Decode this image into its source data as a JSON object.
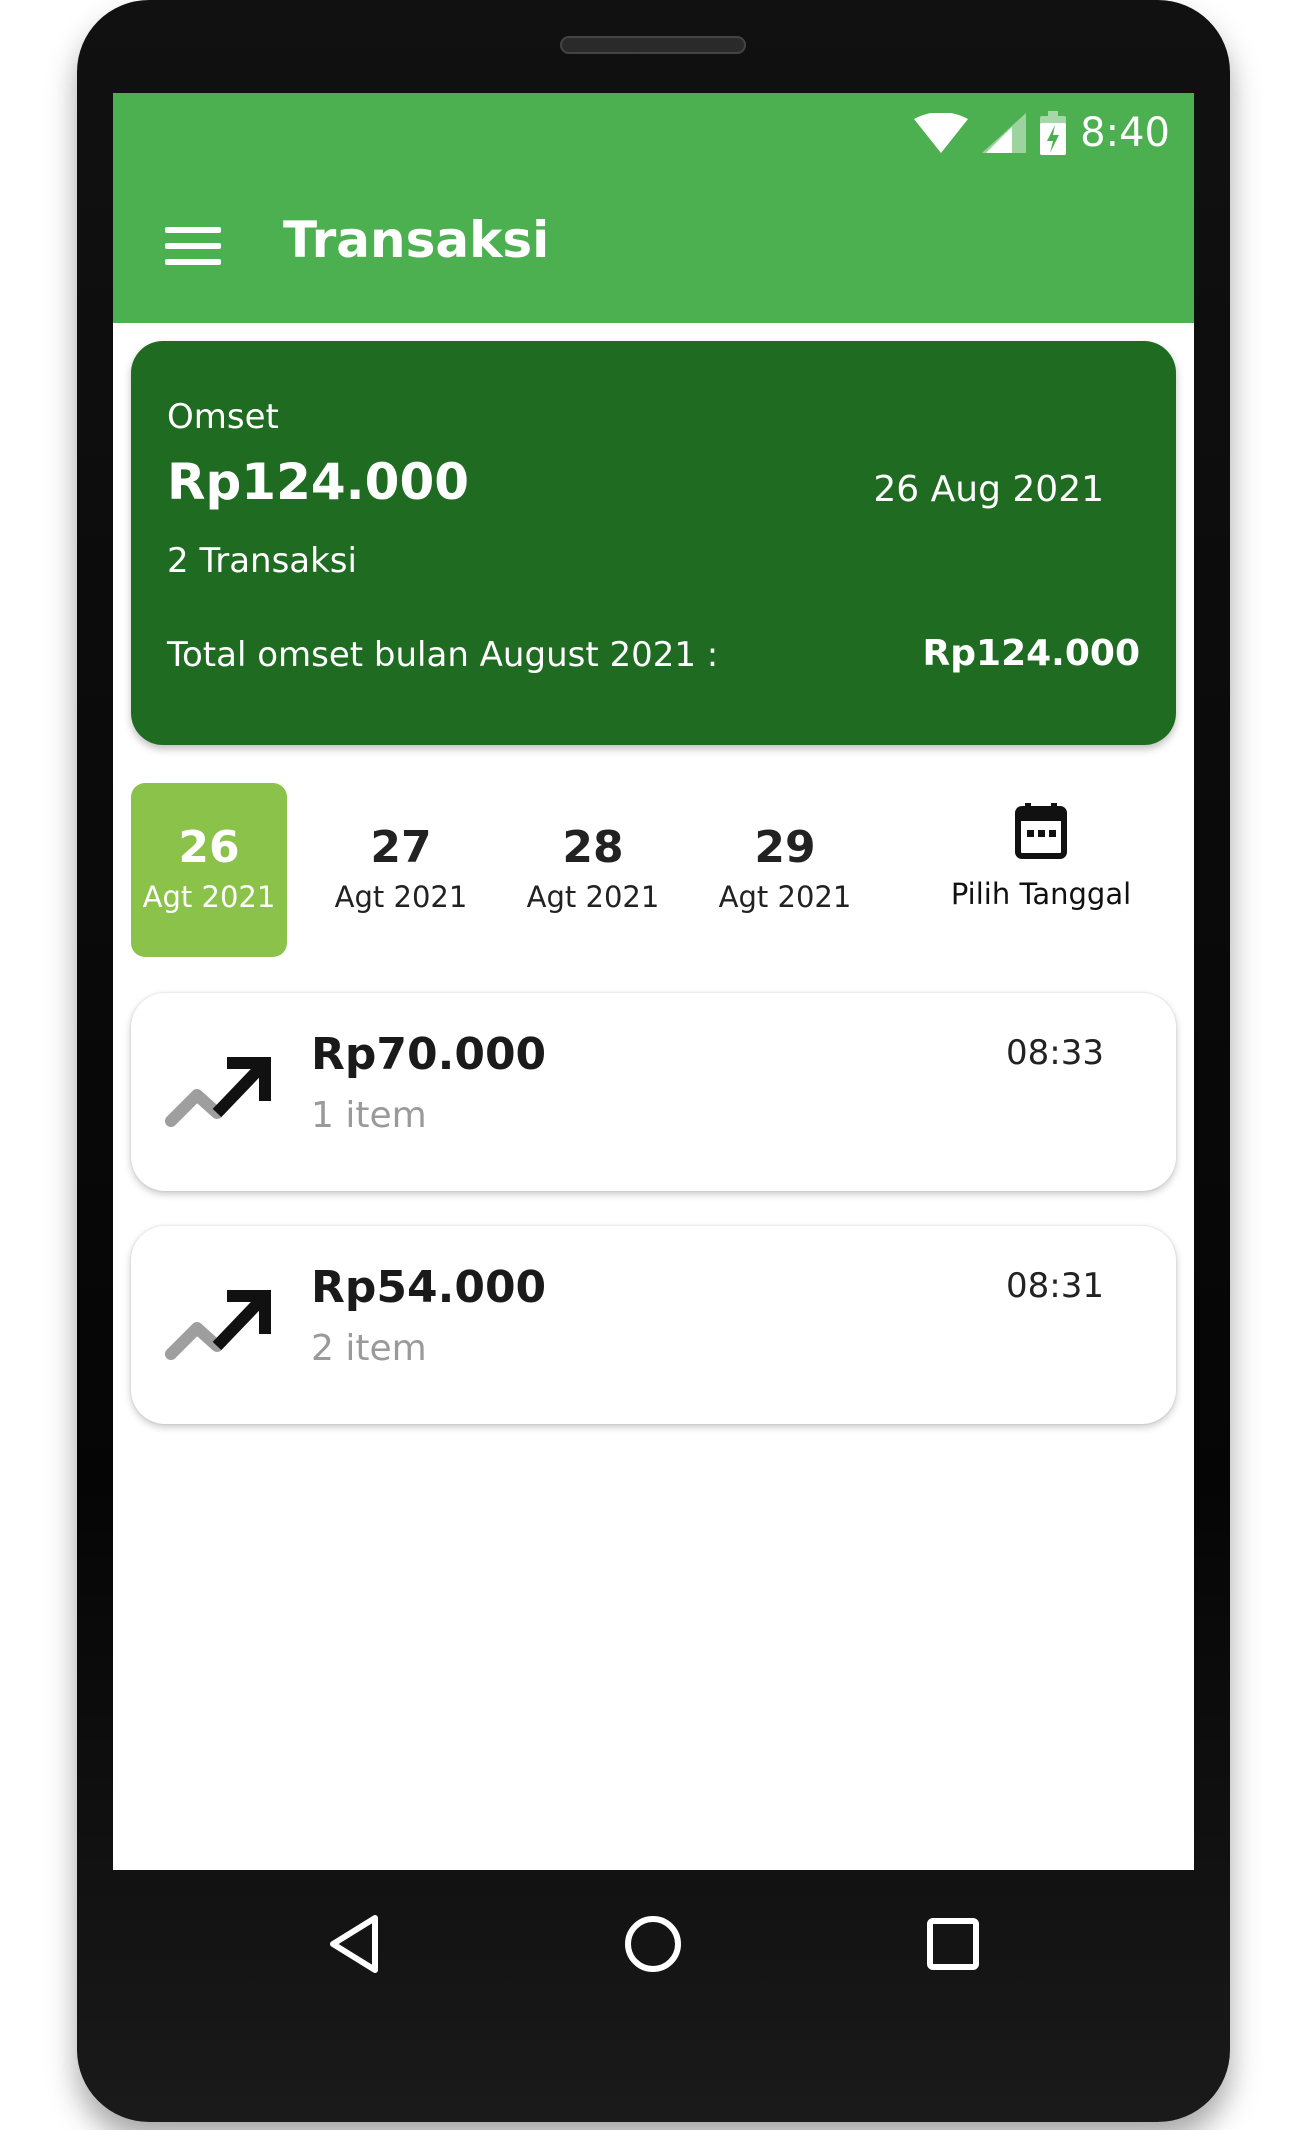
{
  "status_bar": {
    "time": "8:40",
    "icons": [
      "wifi-icon",
      "signal-icon",
      "battery-charging-icon"
    ]
  },
  "app_bar": {
    "title": "Transaksi",
    "menu_icon": "menu-icon"
  },
  "summary": {
    "label": "Omset",
    "amount": "Rp124.000",
    "date": "26 Aug 2021",
    "transaction_count": "2 Transaksi",
    "month_label": "Total omset bulan August 2021 :",
    "month_total": "Rp124.000"
  },
  "date_selector": {
    "dates": [
      {
        "day": "26",
        "month": "Agt 2021",
        "selected": true
      },
      {
        "day": "27",
        "month": "Agt 2021",
        "selected": false
      },
      {
        "day": "28",
        "month": "Agt 2021",
        "selected": false
      },
      {
        "day": "29",
        "month": "Agt 2021",
        "selected": false
      }
    ],
    "pick_label": "Pilih Tanggal",
    "pick_icon": "calendar-icon"
  },
  "transactions": [
    {
      "amount": "Rp70.000",
      "items": "1 item",
      "time": "08:33",
      "icon": "trending-up-icon"
    },
    {
      "amount": "Rp54.000",
      "items": "2 item",
      "time": "08:31",
      "icon": "trending-up-icon"
    }
  ],
  "nav_bar": {
    "icons": [
      "back-icon",
      "home-icon",
      "recents-icon"
    ]
  },
  "colors": {
    "appbar": "#4caf50",
    "summary_card": "#1e6b21",
    "selected_date": "#8bc34a"
  }
}
